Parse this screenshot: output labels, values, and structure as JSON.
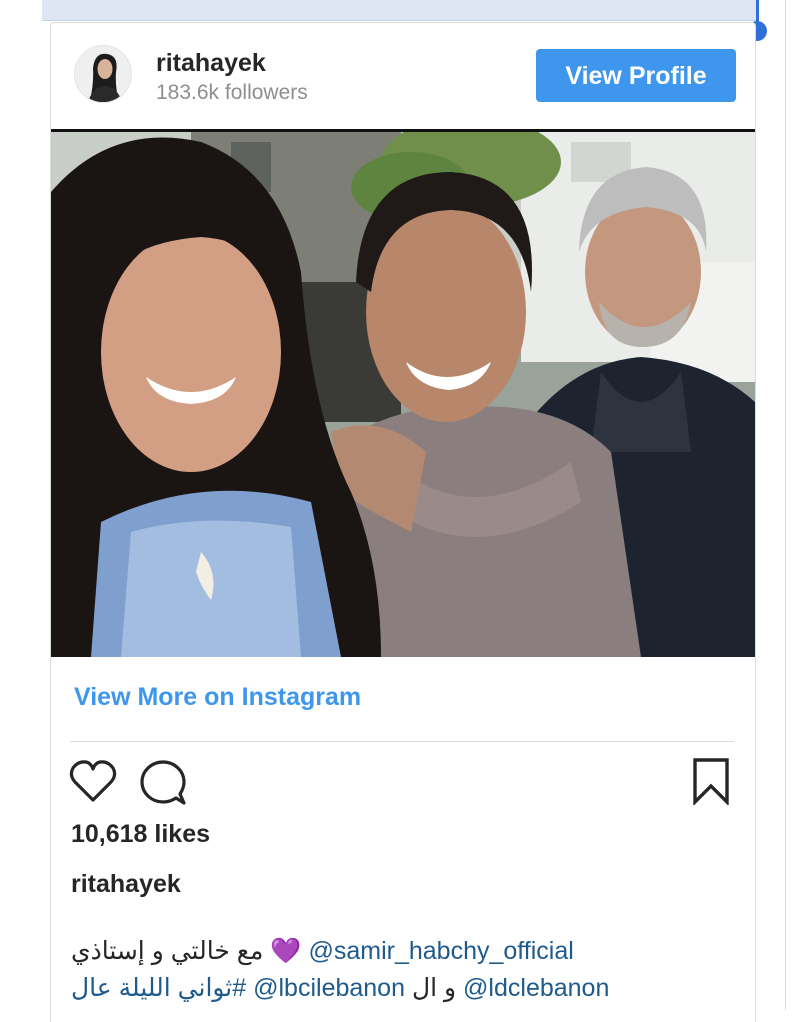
{
  "post": {
    "username": "ritahayek",
    "followers": "183.6k followers",
    "view_profile_label": "View Profile",
    "view_more_label": "View More on Instagram",
    "likes": "10,618 likes",
    "caption_user": "ritahayek",
    "caption_line1": {
      "text_before": "مع خالتي و إستاذي",
      "emoji": "💜",
      "mention": "@samir_habchy_official"
    },
    "caption_line2": {
      "hashtag": "#ثواني الليلة عال",
      "mention_a": "@lbcilebanon",
      "connector": "و ال",
      "mention_b": "@ldclebanon"
    }
  },
  "icons": {
    "like": "heart-icon",
    "comment": "comment-bubble-icon",
    "save": "bookmark-icon"
  },
  "colors": {
    "accent": "#3f97ed",
    "selection": "#2f6fd8",
    "text": "#262626",
    "muted": "#8e8e8e",
    "mention": "#1f5a8c"
  }
}
